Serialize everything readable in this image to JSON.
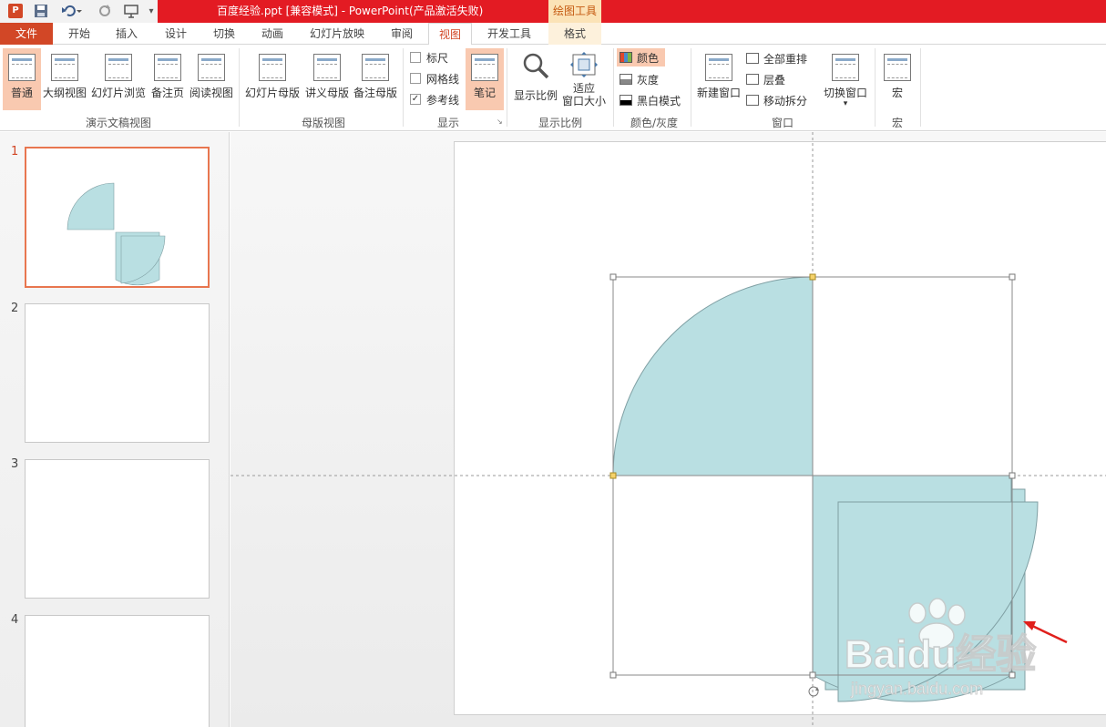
{
  "window": {
    "title": "百度经验.ppt [兼容模式] -  PowerPoint(产品激活失败)",
    "context_group": "绘图工具"
  },
  "tabs": [
    "文件",
    "开始",
    "插入",
    "设计",
    "切换",
    "动画",
    "幻灯片放映",
    "审阅",
    "视图",
    "开发工具",
    "格式"
  ],
  "active_tab": "视图",
  "ribbon": {
    "presentation_views": {
      "label": "演示文稿视图",
      "buttons": [
        "普通",
        "大纲视图",
        "幻灯片浏览",
        "备注页",
        "阅读视图"
      ],
      "selected": "普通"
    },
    "master_views": {
      "label": "母版视图",
      "buttons": [
        "幻灯片母版",
        "讲义母版",
        "备注母版"
      ]
    },
    "show": {
      "label": "显示",
      "checkboxes": [
        {
          "label": "标尺",
          "checked": false
        },
        {
          "label": "网格线",
          "checked": false
        },
        {
          "label": "参考线",
          "checked": true
        }
      ],
      "notes_button": "笔记"
    },
    "zoom": {
      "label": "显示比例",
      "zoom_button": "显示比例",
      "fit_button_line1": "适应",
      "fit_button_line2": "窗口大小"
    },
    "color": {
      "label": "颜色/灰度",
      "options": [
        "颜色",
        "灰度",
        "黑白模式"
      ],
      "selected": "颜色"
    },
    "window": {
      "label": "窗口",
      "new_window": "新建窗口",
      "arrange": [
        "全部重排",
        "层叠",
        "移动拆分"
      ],
      "switch_window": "切换窗口",
      "switch_arrow": "▾"
    },
    "macro": {
      "label": "宏",
      "button": "宏"
    }
  },
  "slides": [
    {
      "number": "1",
      "has_content": true
    },
    {
      "number": "2",
      "has_content": false
    },
    {
      "number": "3",
      "has_content": false
    },
    {
      "number": "4",
      "has_content": false
    }
  ],
  "colors": {
    "title_bar": "#e31b23",
    "file_tab": "#d24726",
    "accent": "#d24726",
    "shape_fill": "#b9dfe2",
    "shape_stroke": "#7f9fa3",
    "selection_handle": "#f5d26b",
    "arrow": "#e0201c",
    "thumb_selected_border": "#e8764f"
  },
  "watermark": {
    "brand": "Baidu经验",
    "url": "jingyan.baidu.com"
  }
}
